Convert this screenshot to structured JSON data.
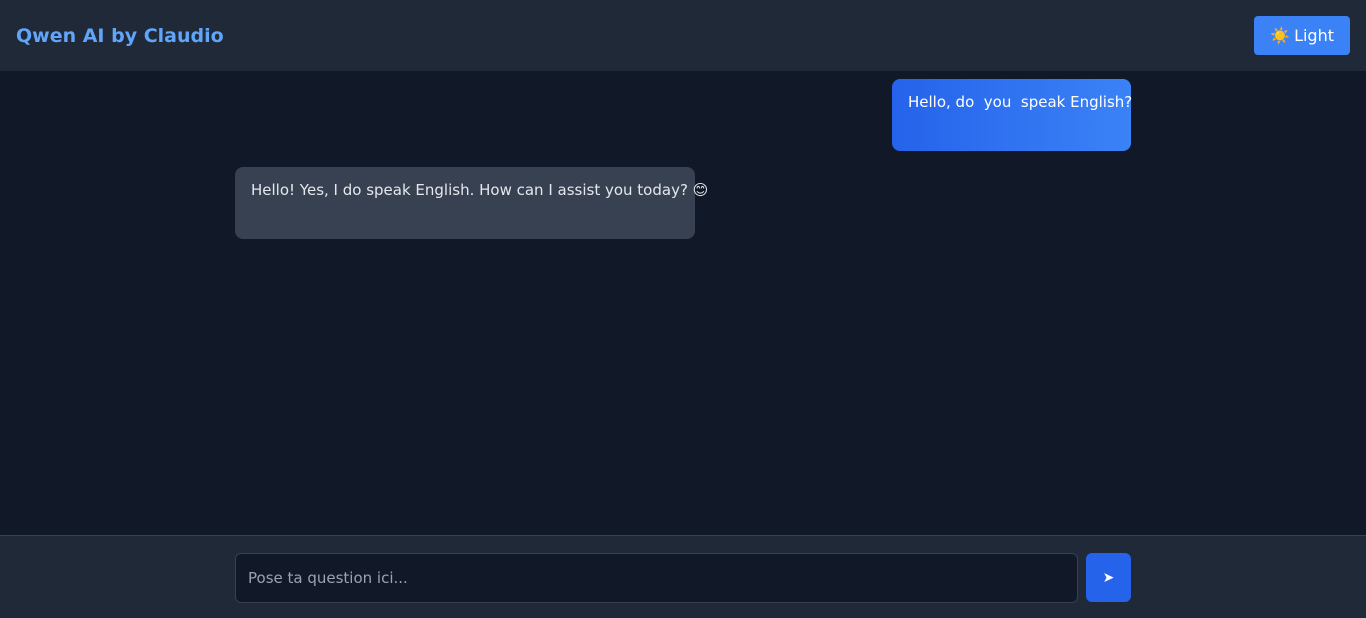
{
  "header": {
    "title": "Qwen AI by Claudio",
    "theme_button": {
      "icon": "sun-icon",
      "glyph": "☀️",
      "label": "Light"
    }
  },
  "messages": [
    {
      "role": "user",
      "text": "Hello, do  you  speak English?"
    },
    {
      "role": "assistant",
      "text": "Hello! Yes, I do speak English. How can I assist you today? 😊"
    }
  ],
  "composer": {
    "placeholder": "Pose ta question ici...",
    "value": "",
    "send_icon": "send-arrow-icon",
    "send_glyph": "➤"
  },
  "colors": {
    "background": "#111827",
    "header": "#1f2937",
    "accent": "#3b82f6",
    "user_bubble": "#2563eb",
    "assistant_bubble": "#374151",
    "brand_text": "#60a5fa"
  }
}
